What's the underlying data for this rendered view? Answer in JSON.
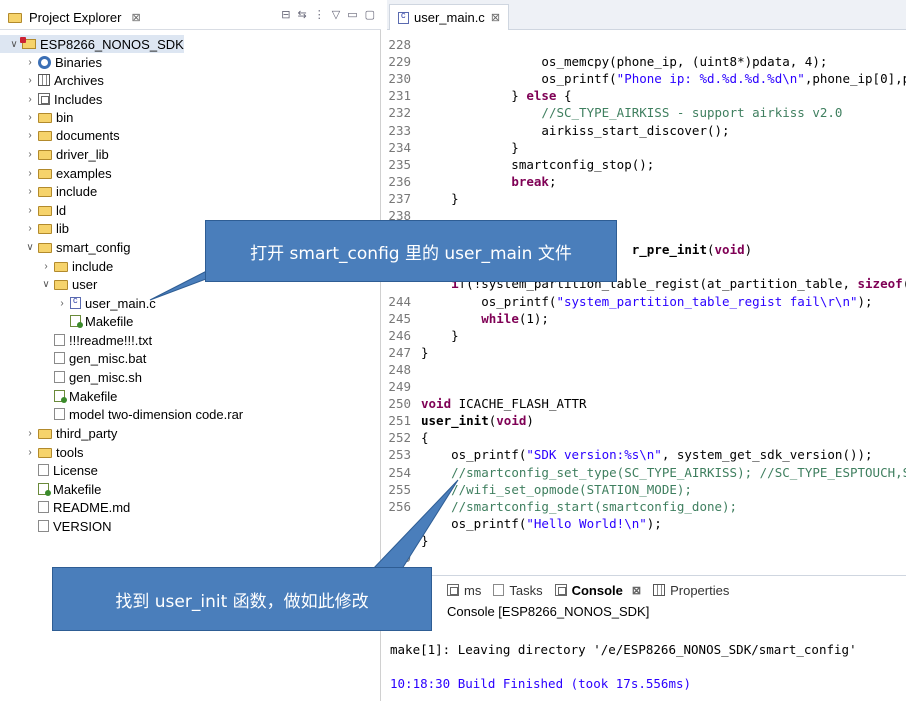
{
  "explorer": {
    "tab_title": "Project Explorer",
    "tab_close": "⊠",
    "tree": [
      {
        "label": "ESP8266_NONOS_SDK",
        "expanded": true,
        "icon": "project-icon"
      },
      {
        "label": "Binaries",
        "icon": "binaries-icon"
      },
      {
        "label": "Archives",
        "icon": "archives-icon"
      },
      {
        "label": "Includes",
        "icon": "includes-icon"
      },
      {
        "label": "bin",
        "icon": "folder-icon"
      },
      {
        "label": "documents",
        "icon": "folder-icon"
      },
      {
        "label": "driver_lib",
        "icon": "folder-icon"
      },
      {
        "label": "examples",
        "icon": "folder-icon"
      },
      {
        "label": "include",
        "icon": "folder-icon"
      },
      {
        "label": "ld",
        "icon": "folder-icon"
      },
      {
        "label": "lib",
        "icon": "folder-icon"
      },
      {
        "label": "smart_config",
        "icon": "folder-icon"
      },
      {
        "label": "include",
        "icon": "folder-icon"
      },
      {
        "label": "user",
        "icon": "folder-icon"
      },
      {
        "label": "user_main.c",
        "icon": "c-file-icon"
      },
      {
        "label": "Makefile",
        "icon": "makefile-icon"
      },
      {
        "label": "!!!readme!!!.txt",
        "icon": "text-file-icon"
      },
      {
        "label": "gen_misc.bat",
        "icon": "text-file-icon"
      },
      {
        "label": "gen_misc.sh",
        "icon": "text-file-icon"
      },
      {
        "label": "Makefile",
        "icon": "makefile-icon"
      },
      {
        "label": "model two-dimension code.rar",
        "icon": "text-file-icon"
      },
      {
        "label": "third_party",
        "icon": "folder-icon"
      },
      {
        "label": "tools",
        "icon": "folder-icon"
      },
      {
        "label": "License",
        "icon": "text-file-icon"
      },
      {
        "label": "Makefile",
        "icon": "makefile-icon"
      },
      {
        "label": "README.md",
        "icon": "text-file-icon"
      },
      {
        "label": "VERSION",
        "icon": "text-file-icon"
      }
    ]
  },
  "editor": {
    "tab_title": "user_main.c",
    "tab_close": "⊠",
    "lines": [
      {
        "n": "228",
        "segs": []
      },
      {
        "n": "229",
        "segs": [
          {
            "t": "                os_memcpy(phone_ip, (uint8*)pdata, 4);"
          }
        ]
      },
      {
        "n": "230",
        "segs": [
          {
            "t": "                os_printf("
          },
          {
            "t": "\"Phone ip: %d.%d.%d.%d\\n\"",
            "c": "str"
          },
          {
            "t": ",phone_ip[0],p"
          }
        ]
      },
      {
        "n": "231",
        "segs": [
          {
            "t": "            } "
          },
          {
            "t": "else",
            "c": "kw"
          },
          {
            "t": " {"
          }
        ]
      },
      {
        "n": "232",
        "segs": [
          {
            "t": "                "
          },
          {
            "t": "//SC_TYPE_AIRKISS - support airkiss v2.0",
            "c": "cm"
          }
        ]
      },
      {
        "n": "233",
        "segs": [
          {
            "t": "                airkiss_start_discover();"
          }
        ]
      },
      {
        "n": "234",
        "segs": [
          {
            "t": "            }"
          }
        ]
      },
      {
        "n": "235",
        "segs": [
          {
            "t": "            smartconfig_stop();"
          }
        ]
      },
      {
        "n": "236",
        "segs": [
          {
            "t": "            "
          },
          {
            "t": "break",
            "c": "kw"
          },
          {
            "t": ";"
          }
        ]
      },
      {
        "n": "237",
        "segs": [
          {
            "t": "    }"
          }
        ]
      },
      {
        "n": "238",
        "segs": []
      },
      {
        "n": "",
        "segs": []
      },
      {
        "n": "",
        "segs": [
          {
            "t": "                            "
          },
          {
            "t": "r_pre_init",
            "c": "fn"
          },
          {
            "t": "("
          },
          {
            "t": "void",
            "c": "kw"
          },
          {
            "t": ")"
          }
        ]
      },
      {
        "n": "",
        "segs": []
      },
      {
        "n": "",
        "segs": [
          {
            "t": "    "
          },
          {
            "t": "i",
            "c": "kw"
          },
          {
            "t": "f(!system_partition_table_regist(at_partition_table, "
          },
          {
            "t": "sizeof",
            "c": "kw"
          },
          {
            "t": "("
          }
        ]
      },
      {
        "n": "244",
        "segs": [
          {
            "t": "        os_printf("
          },
          {
            "t": "\"system_partition_table_regist fail\\r\\n\"",
            "c": "str"
          },
          {
            "t": ");"
          }
        ]
      },
      {
        "n": "245",
        "segs": [
          {
            "t": "        "
          },
          {
            "t": "while",
            "c": "kw"
          },
          {
            "t": "(1);"
          }
        ]
      },
      {
        "n": "246",
        "segs": [
          {
            "t": "    }"
          }
        ]
      },
      {
        "n": "247",
        "segs": [
          {
            "t": "}"
          }
        ]
      },
      {
        "n": "248",
        "segs": []
      },
      {
        "n": "249",
        "segs": []
      },
      {
        "n": "250",
        "segs": [
          {
            "t": "void",
            "c": "kw"
          },
          {
            "t": " ICACHE_FLASH_ATTR"
          }
        ]
      },
      {
        "n": "251",
        "segs": [
          {
            "t": "user_init",
            "c": "fn"
          },
          {
            "t": "("
          },
          {
            "t": "void",
            "c": "kw"
          },
          {
            "t": ")"
          }
        ]
      },
      {
        "n": "252",
        "segs": [
          {
            "t": "{"
          }
        ]
      },
      {
        "n": "253",
        "segs": [
          {
            "t": "    os_printf("
          },
          {
            "t": "\"SDK version:%s\\n\"",
            "c": "str"
          },
          {
            "t": ", system_get_sdk_version());"
          }
        ]
      },
      {
        "n": "254",
        "segs": [
          {
            "t": "    "
          },
          {
            "t": "//smartconfig_set_type(SC_TYPE_AIRKISS); //SC_TYPE_ESPTOUCH,S",
            "c": "cm"
          }
        ]
      },
      {
        "n": "255",
        "segs": [
          {
            "t": "    "
          },
          {
            "t": "//wifi_set_opmode(STATION_MODE);",
            "c": "cm"
          }
        ]
      },
      {
        "n": "256",
        "segs": [
          {
            "t": "    "
          },
          {
            "t": "//smartconfig_start(smartconfig_done);",
            "c": "cm"
          }
        ]
      },
      {
        "n": "",
        "segs": [
          {
            "t": "    os_printf("
          },
          {
            "t": "\"Hello World!\\n\"",
            "c": "str"
          },
          {
            "t": ");"
          }
        ]
      },
      {
        "n": "",
        "segs": [
          {
            "t": "}"
          }
        ]
      },
      {
        "n": "259",
        "segs": []
      }
    ]
  },
  "console": {
    "tabs": [
      {
        "label": "ms",
        "icon": "problems-icon",
        "active": false
      },
      {
        "label": "Tasks",
        "icon": "tasks-icon",
        "active": false
      },
      {
        "label": "Console",
        "icon": "console-icon",
        "active": true,
        "close": "⊠"
      },
      {
        "label": "Properties",
        "icon": "properties-icon",
        "active": false
      }
    ],
    "title": "Console [ESP8266_NONOS_SDK]",
    "lines": [
      {
        "t": "make[1]: Leaving directory '/e/ESP8266_NONOS_SDK/smart_config'",
        "color": "#000000"
      },
      {
        "t": "10:18:30 Build Finished (took 17s.556ms)",
        "color": "#2a00ff"
      }
    ]
  },
  "callouts": {
    "top": "打开 smart_config 里的 user_main 文件",
    "bottom": "找到 user_init 函数，做如此修改"
  },
  "colors": {
    "callout_fill": "#4a7ebb",
    "keyword": "#7f0055",
    "string": "#2a00ff",
    "comment": "#3f7f5f"
  }
}
